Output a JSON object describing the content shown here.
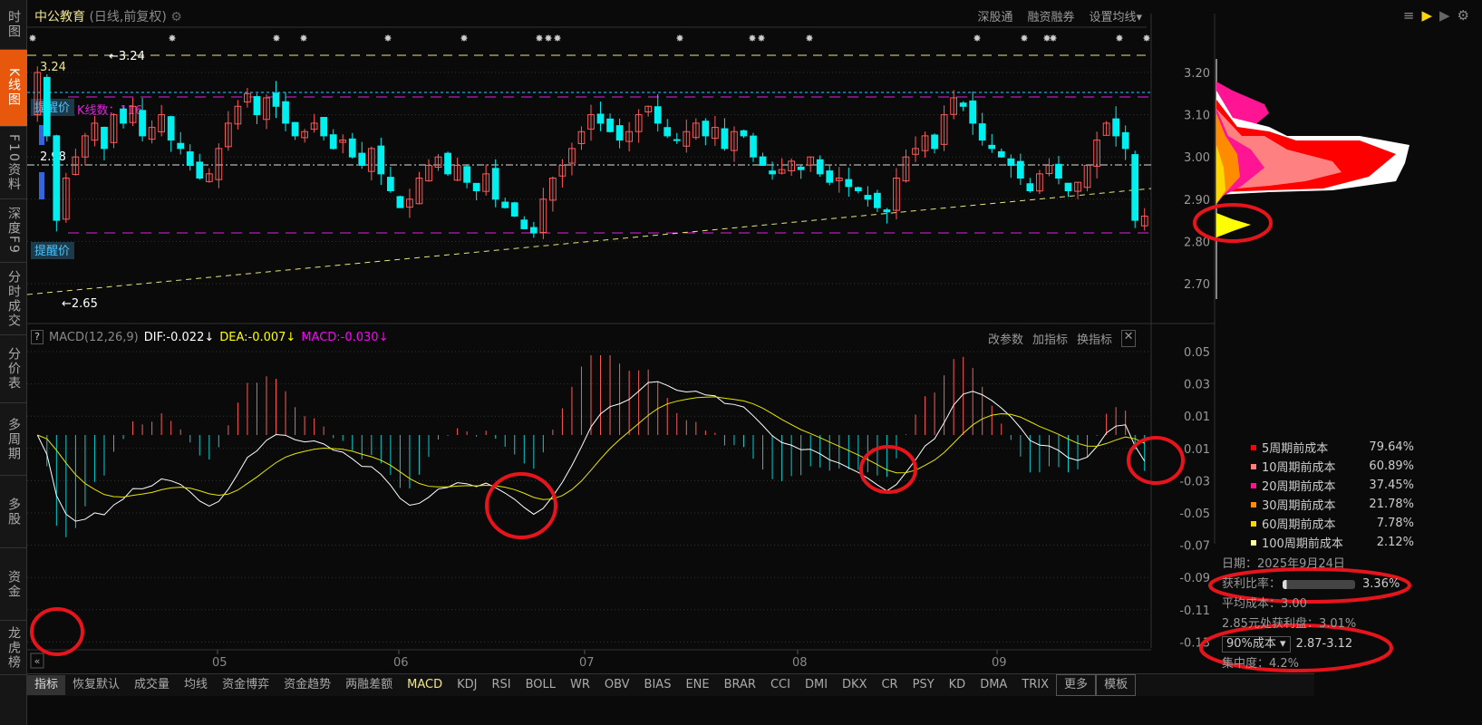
{
  "sidebar": {
    "items": [
      {
        "label": "时图"
      },
      {
        "label": "K线图",
        "active": true
      },
      {
        "label": "F10资料"
      },
      {
        "label": "深度F9"
      },
      {
        "label": "分时成交"
      },
      {
        "label": "分价表"
      },
      {
        "label": "多周期"
      },
      {
        "label": "多股"
      },
      {
        "label": "资金"
      },
      {
        "label": "龙虎榜"
      }
    ]
  },
  "header": {
    "stock_name": "中公教育",
    "period": "(日线,前复权)",
    "links": [
      "深股通",
      "融资融券",
      "设置均线▾"
    ]
  },
  "kline": {
    "high_marker": "←3.24",
    "high_label": "3.24",
    "low_marker": "←2.65",
    "level_label": "2.98",
    "alert_top": "提醒价",
    "alert_bottom": "提醒价",
    "kcount": "K线数：116",
    "closes": [
      3.2,
      3.05,
      2.85,
      2.95,
      3.0,
      3.05,
      3.08,
      3.02,
      3.1,
      3.08,
      3.12,
      3.05,
      3.07,
      3.1,
      3.04,
      3.02,
      2.98,
      2.95,
      2.96,
      3.02,
      3.08,
      3.12,
      3.15,
      3.1,
      3.14,
      3.12,
      3.08,
      3.05,
      3.06,
      3.08,
      3.05,
      3.02,
      3.04,
      3.0,
      2.98,
      3.02,
      2.96,
      2.92,
      2.88,
      2.9,
      2.95,
      2.98,
      3.0,
      2.96,
      2.98,
      2.94,
      2.92,
      2.96,
      2.9,
      2.88,
      2.86,
      2.83,
      2.82,
      2.9,
      2.95,
      2.98,
      3.02,
      3.06,
      3.1,
      3.08,
      3.06,
      3.04,
      3.06,
      3.1,
      3.12,
      3.08,
      3.05,
      3.04,
      3.06,
      3.08,
      3.05,
      3.07,
      3.02,
      3.06,
      3.05,
      3.0,
      2.98,
      2.96,
      2.97,
      2.99,
      2.97,
      3.0,
      2.96,
      2.94,
      2.95,
      2.93,
      2.92,
      2.9,
      2.88,
      2.87,
      2.95,
      3.0,
      3.02,
      3.05,
      3.02,
      3.1,
      3.14,
      3.12,
      3.08,
      3.04,
      3.02,
      3.0,
      2.98,
      2.95,
      2.92,
      2.96,
      2.98,
      2.95,
      2.92,
      2.94,
      2.98,
      3.04,
      3.08,
      3.05,
      3.02,
      2.85,
      2.86
    ],
    "price_axis": [
      "3.20",
      "3.10",
      "3.00",
      "2.90",
      "2.80",
      "2.70"
    ],
    "months": [
      "05",
      "06",
      "07",
      "08",
      "09"
    ]
  },
  "macd": {
    "name": "MACD(12,26,9)",
    "dif": "DIF:-0.022↓",
    "dea": "DEA:-0.007↓",
    "macd": "MACD:-0.030↓",
    "buttons": [
      "改参数",
      "加指标",
      "换指标"
    ],
    "axis": [
      "0.05",
      "0.03",
      "0.01",
      "0.01",
      "-0.03",
      "-0.05",
      "-0.07",
      "-0.09",
      "-0.11",
      "-0.13"
    ]
  },
  "chips": {
    "legend": [
      {
        "label": "5周期前成本",
        "pct": "79.64%",
        "color": "#ff0000"
      },
      {
        "label": "10周期前成本",
        "pct": "60.89%",
        "color": "#ff8080"
      },
      {
        "label": "20周期前成本",
        "pct": "37.45%",
        "color": "#ff1493"
      },
      {
        "label": "30周期前成本",
        "pct": "21.78%",
        "color": "#ff8c00"
      },
      {
        "label": "60周期前成本",
        "pct": "7.78%",
        "color": "#ffd700"
      },
      {
        "label": "100周期前成本",
        "pct": "2.12%",
        "color": "#ffff99"
      }
    ],
    "date": "日期：2025年9月24日",
    "profit_label": "获利比率：",
    "profit_pct": "3.36%",
    "profit_ratio": 0.0336,
    "avg_cost": "平均成本：3.00",
    "profit_at": "2.85元处获利盘：3.01%",
    "cost_select": "90%成本 ▾",
    "cost_range": "2.87-3.12",
    "concentration": "集中度：4.2%"
  },
  "tabs": [
    "指标",
    "恢复默认",
    "成交量",
    "均线",
    "资金博弈",
    "资金趋势",
    "两融差额",
    "MACD",
    "KDJ",
    "RSI",
    "BOLL",
    "WR",
    "OBV",
    "BIAS",
    "ENE",
    "BRAR",
    "CCI",
    "DMI",
    "DKX",
    "CR",
    "PSY",
    "KD",
    "DMA",
    "TRIX",
    "更多",
    "模板"
  ]
}
